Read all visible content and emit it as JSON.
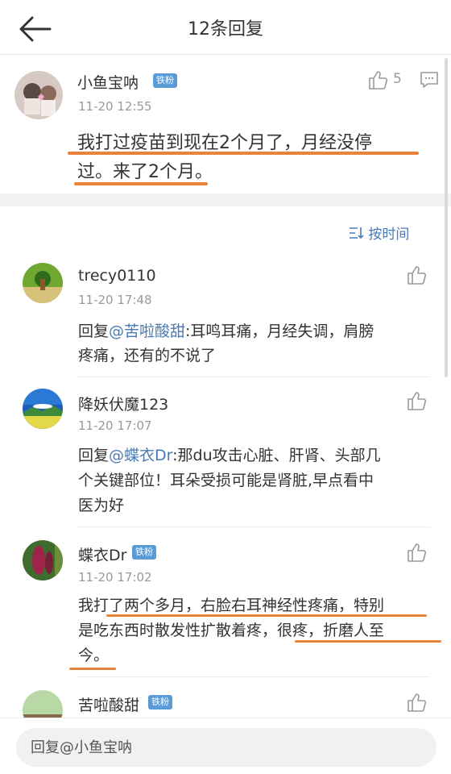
{
  "header": {
    "title": "12条回复"
  },
  "root_comment": {
    "username": "小鱼宝呐",
    "badge": "铁粉",
    "time": "11-20 12:55",
    "like_count": "5",
    "content_line1": "我打过疫苗到现在2个月了，月经没停",
    "content_line2": "过。来了2个月。"
  },
  "sort_label": "按时间",
  "replies": [
    {
      "username": "trecy0110",
      "time": "11-20 17:48",
      "reply_prefix": "回复",
      "mention": "@苦啦酸甜",
      "line1_rest": ":耳鸣耳痛，月经失调，肩膀",
      "line2": "疼痛，还有的不说了"
    },
    {
      "username": "降妖伏魔123",
      "time": "11-20 17:07",
      "reply_prefix": "回复",
      "mention": "@蝶衣Dr",
      "line1_rest": ":那du攻击心脏、肝肾、头部几",
      "line2": "个关键部位！耳朵受损可能是肾脏,早点看中",
      "line3": "医为好"
    },
    {
      "username": "蝶衣Dr",
      "badge": "铁粉",
      "time": "11-20 17:02",
      "line1": "我打了两个多月，右脸右耳神经性疼痛，特别",
      "line2": "是吃东西时散发性扩散着疼，很疼，折磨人至",
      "line3": "今。"
    },
    {
      "username": "苦啦酸甜",
      "badge": "铁粉"
    }
  ],
  "footer": {
    "reply_placeholder": "回复@小鱼宝呐"
  },
  "colors": {
    "link": "#4a7ab5",
    "badge": "#5b9bd5",
    "highlight_underline": "#e8843a"
  }
}
